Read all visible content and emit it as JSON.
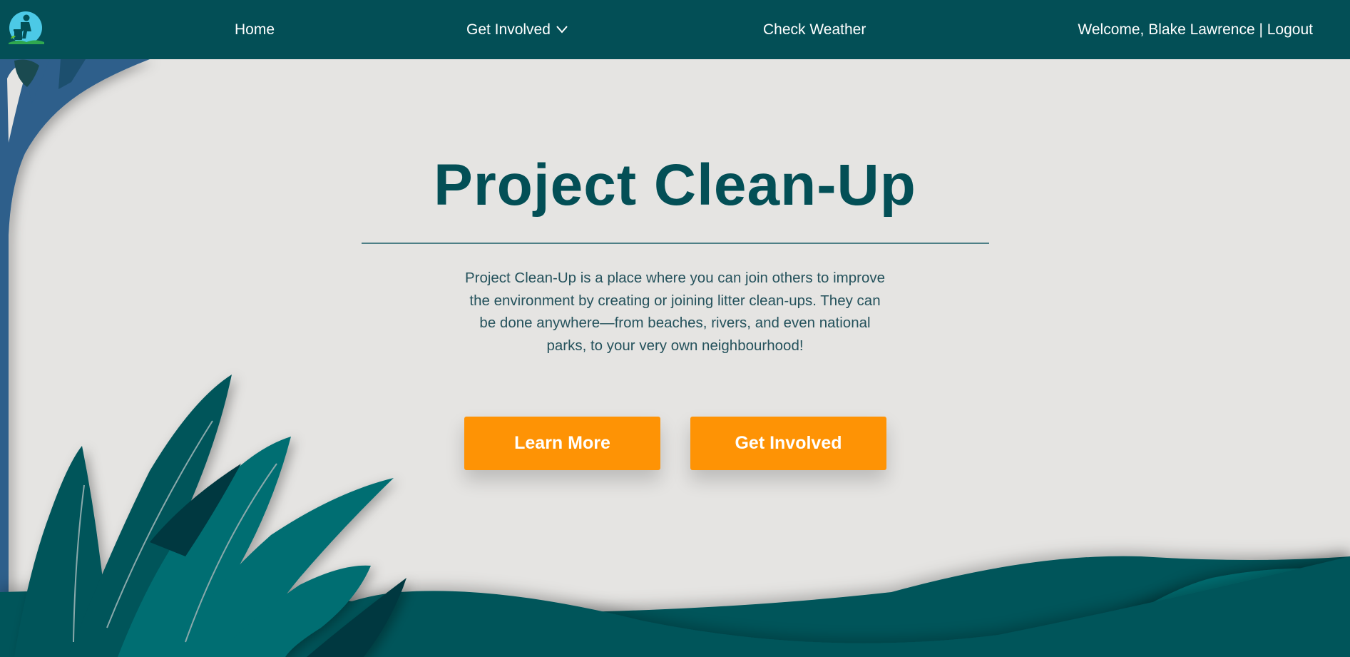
{
  "nav": {
    "home": "Home",
    "get_involved": "Get Involved",
    "check_weather": "Check Weather",
    "user_greeting": "Welcome, Blake Lawrence | Logout"
  },
  "icons": {
    "logo": "person-litter-bin-logo-icon",
    "dropdown": "chevron-down-icon"
  },
  "hero": {
    "title": "Project Clean-Up",
    "description": "Project Clean-Up is a place where you can join others to improve the environment by creating or joining litter clean-ups. They can be done anywhere—from beaches, rivers, and even national parks, to your very own neighbourhood!",
    "learn_more": "Learn More",
    "get_involved": "Get Involved"
  },
  "colors": {
    "nav_bg": "#034f56",
    "page_bg": "#e5e4e2",
    "title": "#034f56",
    "button": "#fe9305",
    "leaf_teal": "#036e72",
    "leaf_dark": "#04545a",
    "tree_blue": "#2d5f8b"
  }
}
